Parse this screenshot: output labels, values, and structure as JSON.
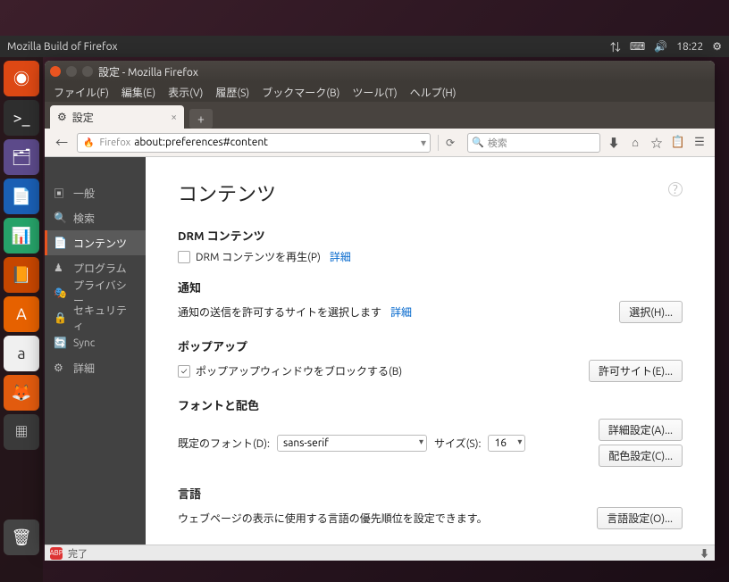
{
  "panel": {
    "title": "Mozilla Build of Firefox",
    "time": "18:22"
  },
  "window": {
    "title": "設定 - Mozilla Firefox"
  },
  "menubar": {
    "file": "ファイル(F)",
    "edit": "編集(E)",
    "view": "表示(V)",
    "history": "履歴(S)",
    "bookmarks": "ブックマーク(B)",
    "tools": "ツール(T)",
    "help": "ヘルプ(H)"
  },
  "tab": {
    "label": "設定"
  },
  "urlbar": {
    "badge": "Firefox",
    "url": "about:preferences#content",
    "search_placeholder": "検索"
  },
  "sidebar": {
    "items": [
      {
        "label": "一般"
      },
      {
        "label": "検索"
      },
      {
        "label": "コンテンツ"
      },
      {
        "label": "プログラム"
      },
      {
        "label": "プライバシー"
      },
      {
        "label": "セキュリティ"
      },
      {
        "label": "Sync"
      },
      {
        "label": "詳細"
      }
    ]
  },
  "main": {
    "heading": "コンテンツ",
    "drm": {
      "title": "DRM コンテンツ",
      "play": "DRM コンテンツを再生(P)",
      "details": "詳細"
    },
    "notif": {
      "title": "通知",
      "desc": "通知の送信を許可するサイトを選択します",
      "details": "詳細",
      "button": "選択(H)..."
    },
    "popup": {
      "title": "ポップアップ",
      "block": "ポップアップウィンドウをブロックする(B)",
      "button": "許可サイト(E)..."
    },
    "font": {
      "title": "フォントと配色",
      "default_label": "既定のフォント(D):",
      "default_value": "sans-serif",
      "size_label": "サイズ(S):",
      "size_value": "16",
      "advanced": "詳細設定(A)...",
      "colors": "配色設定(C)..."
    },
    "lang": {
      "title": "言語",
      "desc": "ウェブページの表示に使用する言語の優先順位を設定できます。",
      "button": "言語設定(O)..."
    }
  },
  "status": {
    "done": "完了"
  }
}
